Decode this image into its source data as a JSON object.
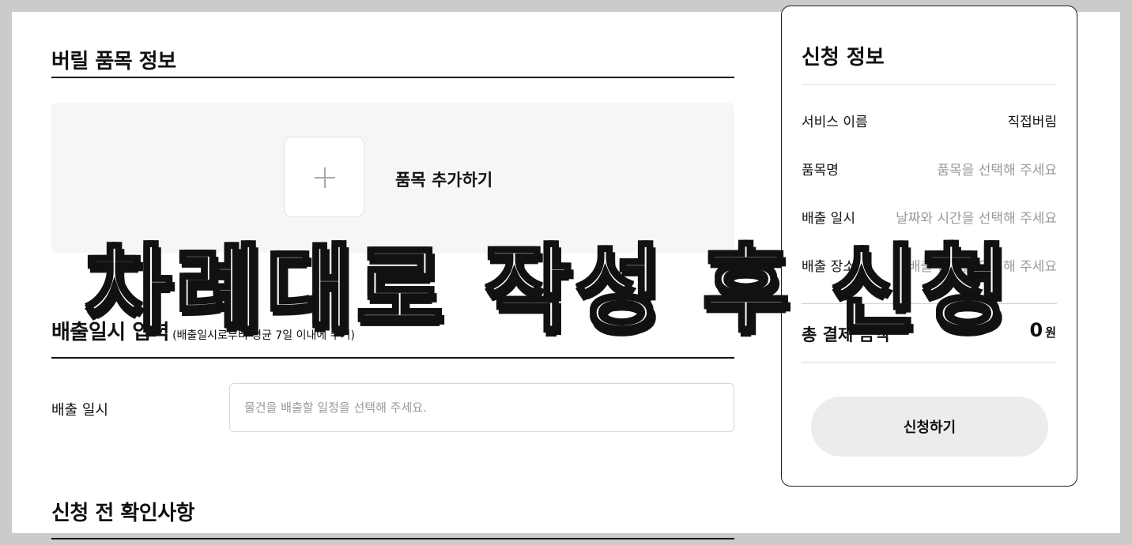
{
  "sections": {
    "items": {
      "title": "버릴 품목 정보",
      "add_label": "품목 추가하기"
    },
    "schedule": {
      "title": "배출일시 입력",
      "note": "(배출일시로부터 평균 7일 이내에 수거)",
      "field_label": "배출 일시",
      "placeholder": "물건을 배출할 일정을 선택해 주세요."
    },
    "confirm": {
      "title": "신청 전 확인사항"
    }
  },
  "summary": {
    "title": "신청 정보",
    "rows": [
      {
        "label": "서비스 이름",
        "value": "직접버림",
        "placeholder": false
      },
      {
        "label": "품목명",
        "value": "품목을 선택해 주세요",
        "placeholder": true
      },
      {
        "label": "배출 일시",
        "value": "날짜와 시간을 선택해 주세요",
        "placeholder": true
      },
      {
        "label": "배출 장소",
        "value": "배출 장소를 입력해 주세요",
        "placeholder": true
      }
    ],
    "total_label": "총 결제 금액",
    "total_value": "0",
    "total_unit": "원",
    "submit_label": "신청하기"
  },
  "overlay_caption": "차례대로 작성 후 신청"
}
